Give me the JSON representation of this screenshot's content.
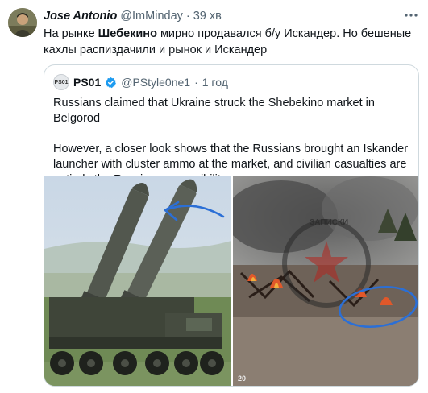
{
  "tweet": {
    "author_name": "Jose Antonio",
    "author_handle": "@ImMinday",
    "separator": "·",
    "time": "39 хв",
    "more_icon": "more-icon",
    "text_before": "На рынке ",
    "text_bold": "Шебекино",
    "text_after": " мирно продавался б/у Искандер. Но бешеные кахлы распиздачили и рынок и Искандер"
  },
  "quote": {
    "avatar_label": "PS01",
    "author_name": "PS01",
    "verified_icon": "verified-badge-icon",
    "author_handle": "@PStyle0ne1",
    "separator": "·",
    "time": "1 год",
    "paragraph_1": "Russians claimed that Ukraine struck the Shebekino market in Belgorod",
    "paragraph_2": "However, a closer look shows that the Russians brought an Iskander launcher with cluster ammo at the market, and civilian casualties are entirely the Russian responsibility",
    "images": [
      {
        "name": "iskander-launcher-photo",
        "annotation": "blue arrow"
      },
      {
        "name": "market-fire-photo",
        "annotation": "blue circle",
        "watermark_text": "ЗАПИСКИ",
        "corner_label": "20"
      }
    ]
  },
  "colors": {
    "accent_blue": "#1d9bf0",
    "annotation_blue": "#2b6fd6",
    "text_primary": "#0f1419",
    "text_secondary": "#536471",
    "border": "#cfd9de"
  }
}
